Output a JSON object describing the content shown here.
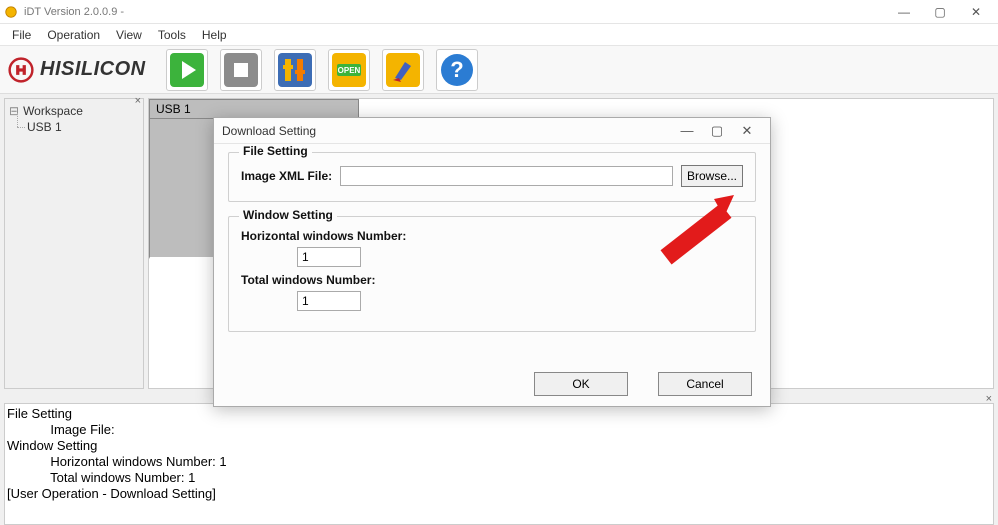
{
  "window": {
    "title": "iDT Version 2.0.0.9 -",
    "buttons": {
      "min": "—",
      "max": "▢",
      "close": "✕"
    }
  },
  "menu": {
    "items": [
      "File",
      "Operation",
      "View",
      "Tools",
      "Help"
    ]
  },
  "logo_text": "HISILICON",
  "toolbar": {
    "open_label": "OPEN"
  },
  "sidebar": {
    "root": "Workspace",
    "children": [
      "USB 1"
    ]
  },
  "main": {
    "tab": "USB 1"
  },
  "dialog": {
    "title": "Download Setting",
    "winbuttons": {
      "min": "—",
      "max": "▢",
      "close": "✕"
    },
    "file_group": "File Setting",
    "image_label": "Image XML File:",
    "image_value": "",
    "browse": "Browse...",
    "window_group": "Window Setting",
    "hwin_label": "Horizontal windows Number:",
    "hwin_value": "1",
    "twin_label": "Total windows Number:",
    "twin_value": "1",
    "ok": "OK",
    "cancel": "Cancel"
  },
  "log": {
    "lines": [
      "File Setting",
      "            Image File:",
      "Window Setting",
      "            Horizontal windows Number: 1",
      "            Total windows Number: 1",
      "[User Operation - Download Setting]"
    ]
  }
}
